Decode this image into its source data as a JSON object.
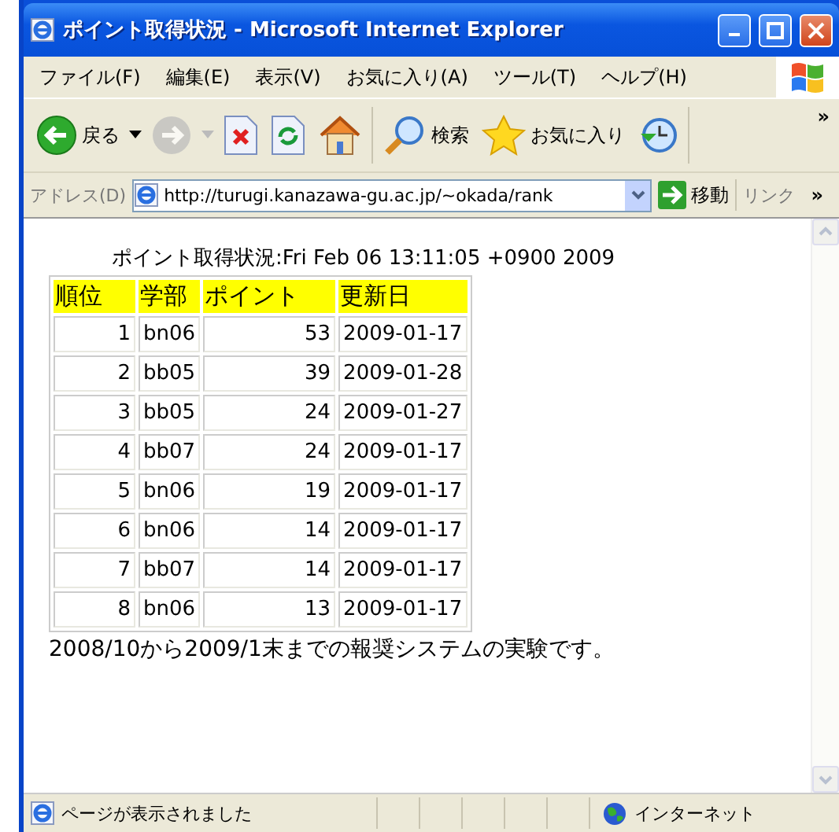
{
  "window": {
    "title": "ポイント取得状況 - Microsoft Internet Explorer"
  },
  "menu": [
    "ファイル(F)",
    "編集(E)",
    "表示(V)",
    "お気に入り(A)",
    "ツール(T)",
    "ヘルプ(H)"
  ],
  "toolbar": [
    {
      "kind": "back",
      "label": "戻る"
    },
    {
      "kind": "forward",
      "disabled": true
    },
    {
      "kind": "stop"
    },
    {
      "kind": "refresh"
    },
    {
      "kind": "home"
    },
    {
      "kind": "search",
      "label": "検索"
    },
    {
      "kind": "favorites",
      "label": "お気に入り"
    },
    {
      "kind": "history"
    }
  ],
  "toolbar_more": "»",
  "address": {
    "label": "アドレス(D)",
    "value": "http://turugi.kanazawa-gu.ac.jp/~okada/rank",
    "go": "移動",
    "links": "リンク",
    "links_more": "»"
  },
  "page": {
    "heading": "ポイント取得状況:Fri Feb 06 13:11:05 +0900 2009",
    "table": {
      "columns": [
        "順位",
        "学部",
        "ポイント",
        "更新日"
      ],
      "rows": [
        [
          "1",
          "bn06",
          "53",
          "2009-01-17"
        ],
        [
          "2",
          "bb05",
          "39",
          "2009-01-28"
        ],
        [
          "3",
          "bb05",
          "24",
          "2009-01-27"
        ],
        [
          "4",
          "bb07",
          "24",
          "2009-01-17"
        ],
        [
          "5",
          "bn06",
          "19",
          "2009-01-17"
        ],
        [
          "6",
          "bn06",
          "14",
          "2009-01-17"
        ],
        [
          "7",
          "bb07",
          "14",
          "2009-01-17"
        ],
        [
          "8",
          "bn06",
          "13",
          "2009-01-17"
        ]
      ]
    },
    "note": "2008/10から2009/1末までの報奨システムの実験です。"
  },
  "status_bar": {
    "text": "ページが表示されました",
    "zone": "インターネット"
  }
}
